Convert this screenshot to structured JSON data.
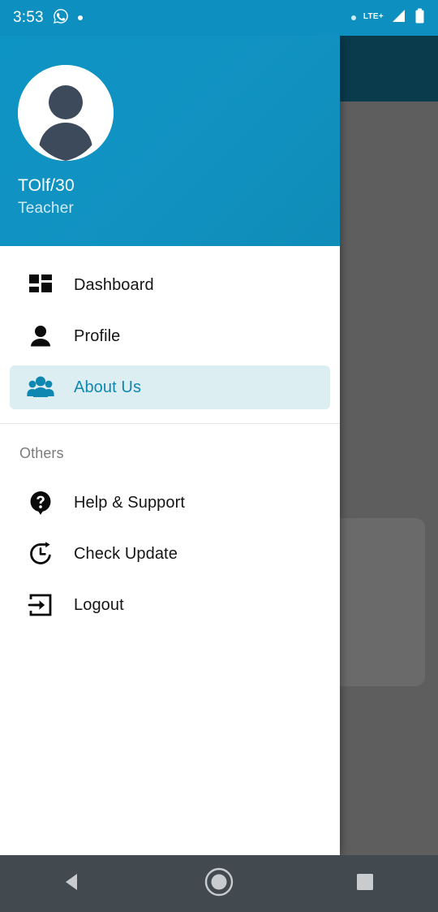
{
  "status_bar": {
    "time": "3:53",
    "left_icons": [
      {
        "name": "whatsapp-icon",
        "label": "WhatsApp"
      },
      {
        "name": "notification-dot-icon",
        "label": ""
      }
    ],
    "right_icons": [
      {
        "name": "notification-dot-icon",
        "label": ""
      },
      {
        "name": "network-type-label",
        "label": "LTE+"
      },
      {
        "name": "signal-icon",
        "label": ""
      },
      {
        "name": "battery-icon",
        "label": ""
      }
    ],
    "network_type": "LTE+",
    "background_color": "#0d90bf"
  },
  "drawer": {
    "header": {
      "avatar_icon": "person-avatar-icon",
      "user_name": "TOlf/30",
      "user_role": "Teacher",
      "background_color": "#1190c2"
    },
    "primary_items": [
      {
        "icon": "dashboard-grid-icon",
        "label": "Dashboard",
        "active": false
      },
      {
        "icon": "person-icon",
        "label": "Profile",
        "active": false
      },
      {
        "icon": "people-group-icon",
        "label": "About Us",
        "active": true
      }
    ],
    "section_label": "Others",
    "secondary_items": [
      {
        "icon": "help-question-icon",
        "label": "Help & Support",
        "active": false
      },
      {
        "icon": "update-clock-icon",
        "label": "Check Update",
        "active": false
      },
      {
        "icon": "logout-exit-icon",
        "label": "Logout",
        "active": false
      }
    ],
    "active_color": "#0f87b0",
    "active_background": "#ddeef3"
  },
  "nav_bar": {
    "buttons": [
      {
        "icon": "back-triangle-icon",
        "label": "Back"
      },
      {
        "icon": "home-circle-icon",
        "label": "Home"
      },
      {
        "icon": "recents-square-icon",
        "label": "Recents"
      }
    ],
    "background_color": "#434a4f"
  }
}
